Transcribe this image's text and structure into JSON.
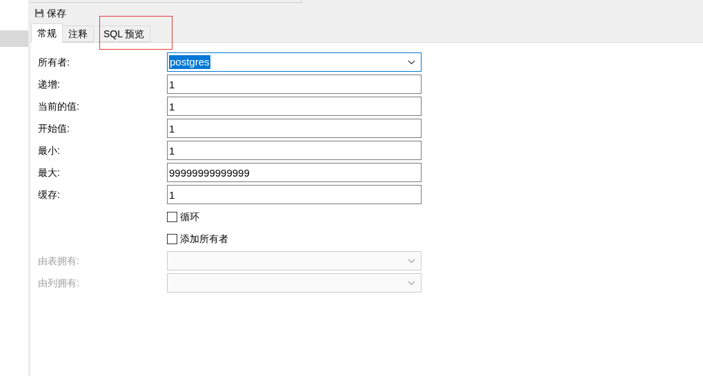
{
  "toolbar": {
    "save_label": "保存"
  },
  "tabs": [
    {
      "label": "常规",
      "selected": true
    },
    {
      "label": "注释",
      "selected": false
    },
    {
      "label": "SQL 预览",
      "selected": false
    }
  ],
  "fields": [
    {
      "kind": "dropdown",
      "label": "所有者:",
      "value": "postgres",
      "focused": true,
      "disabled": false
    },
    {
      "kind": "text",
      "label": "递增:",
      "value": "1",
      "disabled": false
    },
    {
      "kind": "text",
      "label": "当前的值:",
      "value": "1",
      "disabled": false
    },
    {
      "kind": "text",
      "label": "开始值:",
      "value": "1",
      "disabled": false
    },
    {
      "kind": "text",
      "label": "最小:",
      "value": "1",
      "disabled": false
    },
    {
      "kind": "text",
      "label": "最大:",
      "value": "99999999999999",
      "disabled": false
    },
    {
      "kind": "text",
      "label": "缓存:",
      "value": "1",
      "disabled": false
    },
    {
      "kind": "checkbox",
      "label": "循环",
      "checked": false
    },
    {
      "kind": "checkbox",
      "label": "添加所有者",
      "checked": false
    },
    {
      "kind": "dropdown",
      "label": "由表拥有:",
      "focused": false,
      "disabled": true
    },
    {
      "kind": "dropdown",
      "label": "由列拥有:",
      "focused": false,
      "disabled": true
    }
  ]
}
